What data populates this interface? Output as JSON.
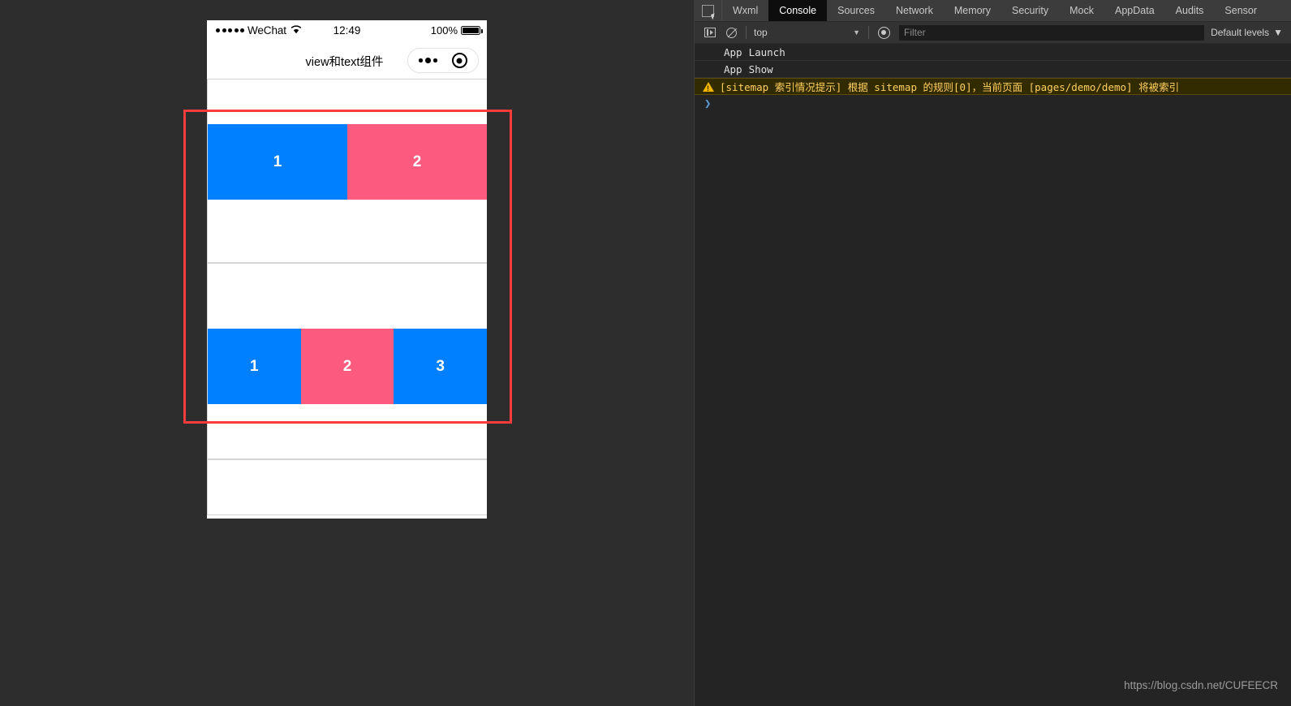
{
  "simulator": {
    "status_bar": {
      "carrier": "WeChat",
      "time": "12:49",
      "battery_percent": "100%",
      "signal_dots": 5,
      "wifi_icon": "wifi-icon",
      "battery_icon": "battery-full-icon"
    },
    "nav_bar": {
      "title": "view和text组件",
      "capsule": {
        "menu_icon": "more-dots-icon",
        "target_icon": "target-circle-icon"
      }
    },
    "page": {
      "sections": [
        {
          "name": "flex-row-two-items",
          "boxes": [
            {
              "label": "1",
              "color": "#007FFF",
              "flex": 2
            },
            {
              "label": "2",
              "color": "#FC5B7F",
              "flex": 2
            }
          ]
        },
        {
          "name": "flex-row-three-items",
          "boxes": [
            {
              "label": "1",
              "color": "#007FFF",
              "flex": 1
            },
            {
              "label": "2",
              "color": "#FC5B7F",
              "flex": 1
            },
            {
              "label": "3",
              "color": "#007FFF",
              "flex": 1
            }
          ]
        }
      ]
    },
    "highlight_rect_color": "#FA3C3C"
  },
  "devtools": {
    "tabs": [
      {
        "label": "Wxml",
        "active": false
      },
      {
        "label": "Console",
        "active": true
      },
      {
        "label": "Sources",
        "active": false
      },
      {
        "label": "Network",
        "active": false
      },
      {
        "label": "Memory",
        "active": false
      },
      {
        "label": "Security",
        "active": false
      },
      {
        "label": "Mock",
        "active": false
      },
      {
        "label": "AppData",
        "active": false
      },
      {
        "label": "Audits",
        "active": false
      },
      {
        "label": "Sensor",
        "active": false
      }
    ],
    "inspect_icon": "inspect-element-icon",
    "toolbar": {
      "sidebar_toggle_icon": "sidebar-toggle-icon",
      "clear_console_icon": "clear-console-icon",
      "context": "top",
      "context_caret": "▼",
      "eye_icon": "live-expression-eye-icon",
      "filter_placeholder": "Filter",
      "filter_value": "",
      "levels": "Default levels",
      "levels_caret": "▼"
    },
    "console_rows": [
      {
        "type": "info",
        "prefix": "App",
        "text": "Launch"
      },
      {
        "type": "info",
        "prefix": "App",
        "text": "Show"
      },
      {
        "type": "warning",
        "icon": "warning-triangle-icon",
        "text": "[sitemap 索引情况提示] 根据 sitemap 的规则[0]，当前页面 [pages/demo/demo] 将被索引"
      },
      {
        "type": "prompt",
        "text": "❯"
      }
    ]
  },
  "watermark": "https://blog.csdn.net/CUFEECR"
}
